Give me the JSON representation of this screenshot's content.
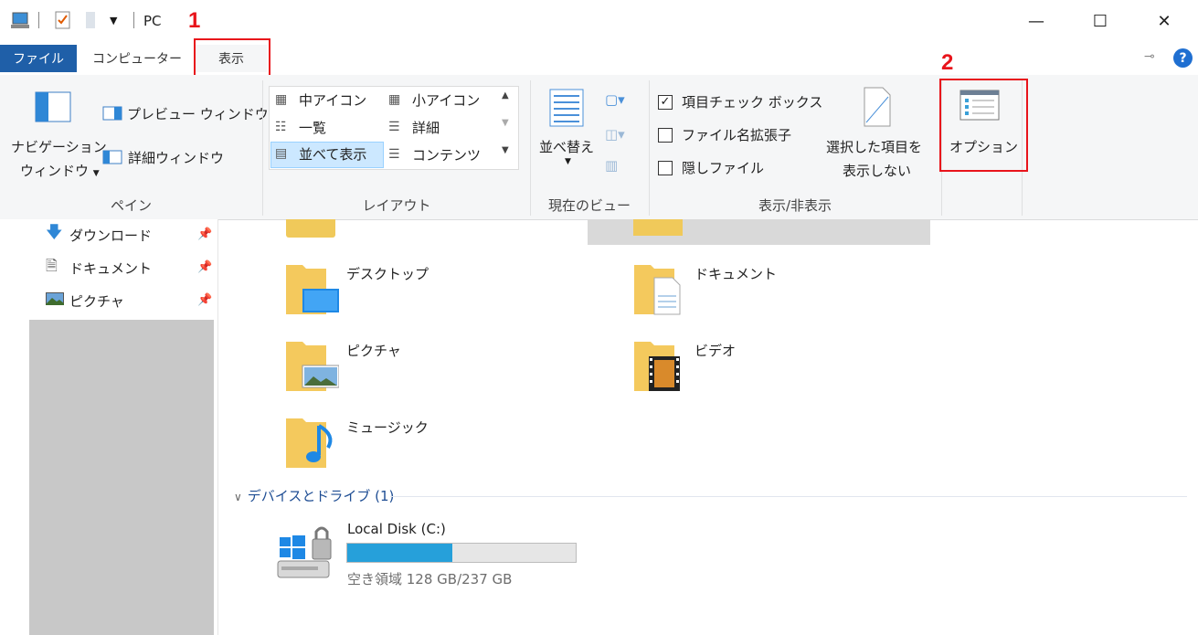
{
  "window": {
    "title": "PC",
    "minimize": "—",
    "maximize": "☐",
    "close": "✕"
  },
  "tabs": {
    "file": "ファイル",
    "computer": "コンピューター",
    "view": "表示"
  },
  "annotations": {
    "step1": "1",
    "step2": "2"
  },
  "ribbon": {
    "pane": {
      "nav_pane_line1": "ナビゲーション",
      "nav_pane_line2": "ウィンドウ",
      "preview_pane": "プレビュー ウィンドウ",
      "details_pane": "詳細ウィンドウ",
      "group_label": "ペイン"
    },
    "layout": {
      "medium_icons": "中アイコン",
      "small_icons": "小アイコン",
      "list": "一覧",
      "details": "詳細",
      "tiles": "並べて表示",
      "content": "コンテンツ",
      "group_label": "レイアウト"
    },
    "current_view": {
      "sort_by": "並べ替え",
      "group_label": "現在のビュー"
    },
    "show_hide": {
      "item_checkboxes": "項目チェック ボックス",
      "item_checkboxes_checked": true,
      "file_extensions": "ファイル名拡張子",
      "file_extensions_checked": false,
      "hidden_items": "隠しファイル",
      "hidden_items_checked": false,
      "hide_selected_line1": "選択した項目を",
      "hide_selected_line2": "表示しない",
      "group_label": "表示/非表示"
    },
    "options": {
      "label": "オプション"
    }
  },
  "nav_pane": {
    "items": [
      {
        "label": "ダウンロード",
        "icon": "download-icon"
      },
      {
        "label": "ドキュメント",
        "icon": "document-icon"
      },
      {
        "label": "ピクチャ",
        "icon": "picture-icon"
      }
    ]
  },
  "folders": {
    "desktop": "デスクトップ",
    "documents": "ドキュメント",
    "pictures": "ピクチャ",
    "videos": "ビデオ",
    "music": "ミュージック"
  },
  "drives": {
    "section_title": "デバイスとドライブ (1)",
    "local_disk": {
      "name": "Local Disk (C:)",
      "free_text": "空き領域 128 GB/237 GB",
      "used_fraction": 0.46
    }
  },
  "colors": {
    "accent": "#1f5fa8",
    "annotation_red": "#e8141b",
    "drive_bar": "#26a0da"
  }
}
